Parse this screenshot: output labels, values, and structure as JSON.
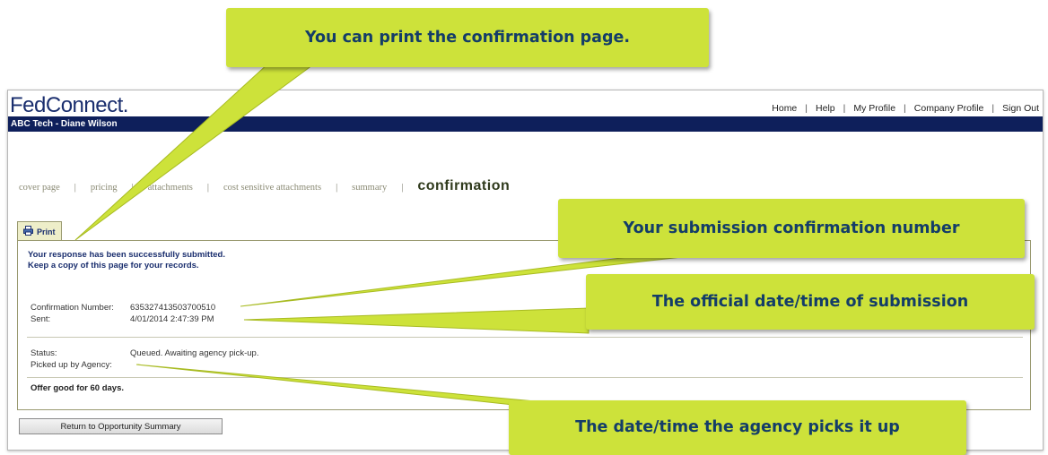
{
  "app": {
    "logo": "FedConnect.",
    "user_bar": "ABC Tech - Diane Wilson",
    "nav": {
      "home": "Home",
      "help": "Help",
      "my_profile": "My Profile",
      "company_profile": "Company Profile",
      "sign_out": "Sign Out",
      "separator": "|"
    }
  },
  "steps": {
    "items": [
      "cover page",
      "pricing",
      "attachments",
      "cost sensitive attachments",
      "summary"
    ],
    "current": "confirmation",
    "separator": "|"
  },
  "print_tab": {
    "label": "Print"
  },
  "confirmation": {
    "message_line1": "Your response has been successfully submitted.",
    "message_line2": "Keep a copy of this page for your records.",
    "confirmation_number_label": "Confirmation Number:",
    "confirmation_number_value": "635327413503700510",
    "sent_label": "Sent:",
    "sent_value": "4/01/2014 2:47:39 PM",
    "status_label": "Status:",
    "status_value": "Queued. Awaiting agency pick-up.",
    "picked_up_label": "Picked up by Agency:",
    "offer_text": "Offer good for 60 days."
  },
  "return_button": {
    "label": "Return to Opportunity Summary"
  },
  "callouts": {
    "print": "You can print the confirmation page.",
    "confirmation_number": "Your submission confirmation number",
    "official_time": "The official date/time of submission",
    "agency_pickup": "The date/time the agency picks it up"
  },
  "colors": {
    "callout": "#cde23a",
    "callout_text": "#143d68",
    "user_bar": "#0e1f5b",
    "logo": "#1a2e6e"
  }
}
